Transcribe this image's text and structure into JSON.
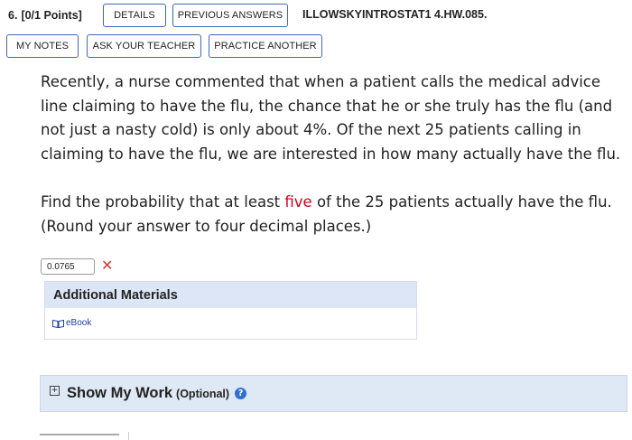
{
  "header": {
    "question_number": "6.",
    "points": "[0/1 Points]",
    "details_label": "DETAILS",
    "previous_answers_label": "PREVIOUS ANSWERS",
    "assignment_id": "ILLOWSKYINTROSTAT1 4.HW.085."
  },
  "toolbar": {
    "my_notes_label": "MY NOTES",
    "ask_teacher_label": "ASK YOUR TEACHER",
    "practice_another_label": "PRACTICE ANOTHER"
  },
  "question": {
    "paragraph1": "Recently, a nurse commented that when a patient calls the medical advice line claiming to have the flu, the chance that he or she truly has the flu (and not just a nasty cold) is only about 4%. Of the next 25 patients calling in claiming to have the flu, we are interested in how many actually have the flu.",
    "paragraph2_before": "Find the probability that at least ",
    "paragraph2_highlight": "five",
    "paragraph2_after": " of the 25 patients actually have the flu. (Round your answer to four decimal places.)"
  },
  "answer": {
    "value": "0.0765",
    "status_icon": "incorrect-x-icon",
    "status_symbol": "✕"
  },
  "additional_materials": {
    "title": "Additional Materials",
    "ebook_label": "eBook"
  },
  "show_my_work": {
    "title": "Show My Work",
    "optional_label": "(Optional)",
    "help_symbol": "?"
  },
  "colors": {
    "button_border": "#3f68b5",
    "highlight_red": "#d0021b",
    "incorrect_x": "#d9342b",
    "materials_header_bg": "#dde6f7",
    "show_work_bg": "#dfe8f5"
  }
}
